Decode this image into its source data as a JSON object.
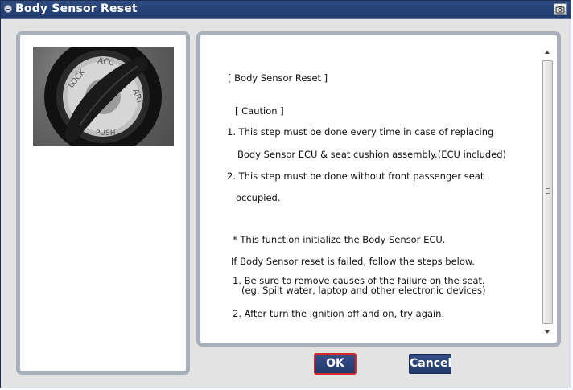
{
  "window": {
    "title": "Body Sensor Reset",
    "title_icon": "app-icon",
    "title_button_icon": "camera-icon"
  },
  "image": {
    "description": "ignition key cylinder",
    "labels": [
      "LOCK",
      "ACC",
      "ART",
      "PUSH"
    ]
  },
  "content": {
    "lines": [
      "[ Body Sensor Reset ]",
      "[ Caution ]",
      "1. This step must be done every time in case of replacing",
      "Body Sensor ECU & seat cushion assembly.(ECU included)",
      "2. This step must be done without front passenger seat",
      "occupied.",
      "* This function initialize the Body Sensor ECU.",
      "If Body Sensor reset is failed, follow the steps below.",
      "1. Be sure to remove causes of the failure on the seat.",
      "(eg. Spilt water, laptop and other electronic devices)",
      "2. After turn the ignition off and on, try again."
    ]
  },
  "buttons": {
    "ok": "OK",
    "cancel": "Cancel"
  },
  "colors": {
    "title_bar": "#203a6c",
    "button": "#2a4478",
    "ok_focus": "#d7282e",
    "panel_border": "#a9b0ba"
  }
}
